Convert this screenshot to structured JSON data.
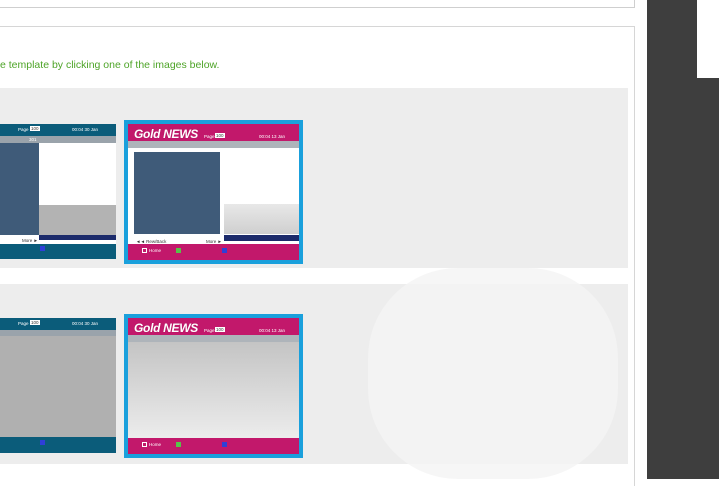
{
  "instruction": "e template by clicking one of the images below.",
  "templates": [
    {
      "page_label": "Page",
      "page_num": "100",
      "time": "00:04  30 Jan",
      "index": "301",
      "more": "More ►"
    },
    {
      "title": "Gold NEWS",
      "page_label": "Page",
      "page_num": "100",
      "time": "00:04  13 Jan",
      "back": "◄◄ Rew/Back",
      "more": "More ►",
      "home": "Home"
    },
    {
      "page_label": "Page",
      "page_num": "100",
      "time": "00:04  30 Jan"
    },
    {
      "title": "Gold NEWS",
      "page_label": "Page",
      "page_num": "100",
      "time": "00:04  13 Jan",
      "home": "Home"
    }
  ],
  "colors": {
    "accent_green": "#4ea428",
    "selection_blue": "#1aa0dc",
    "magenta": "#c2186b",
    "teal": "#0b5c7a",
    "slate": "#3f5b79",
    "navy": "#1c2b6b"
  }
}
